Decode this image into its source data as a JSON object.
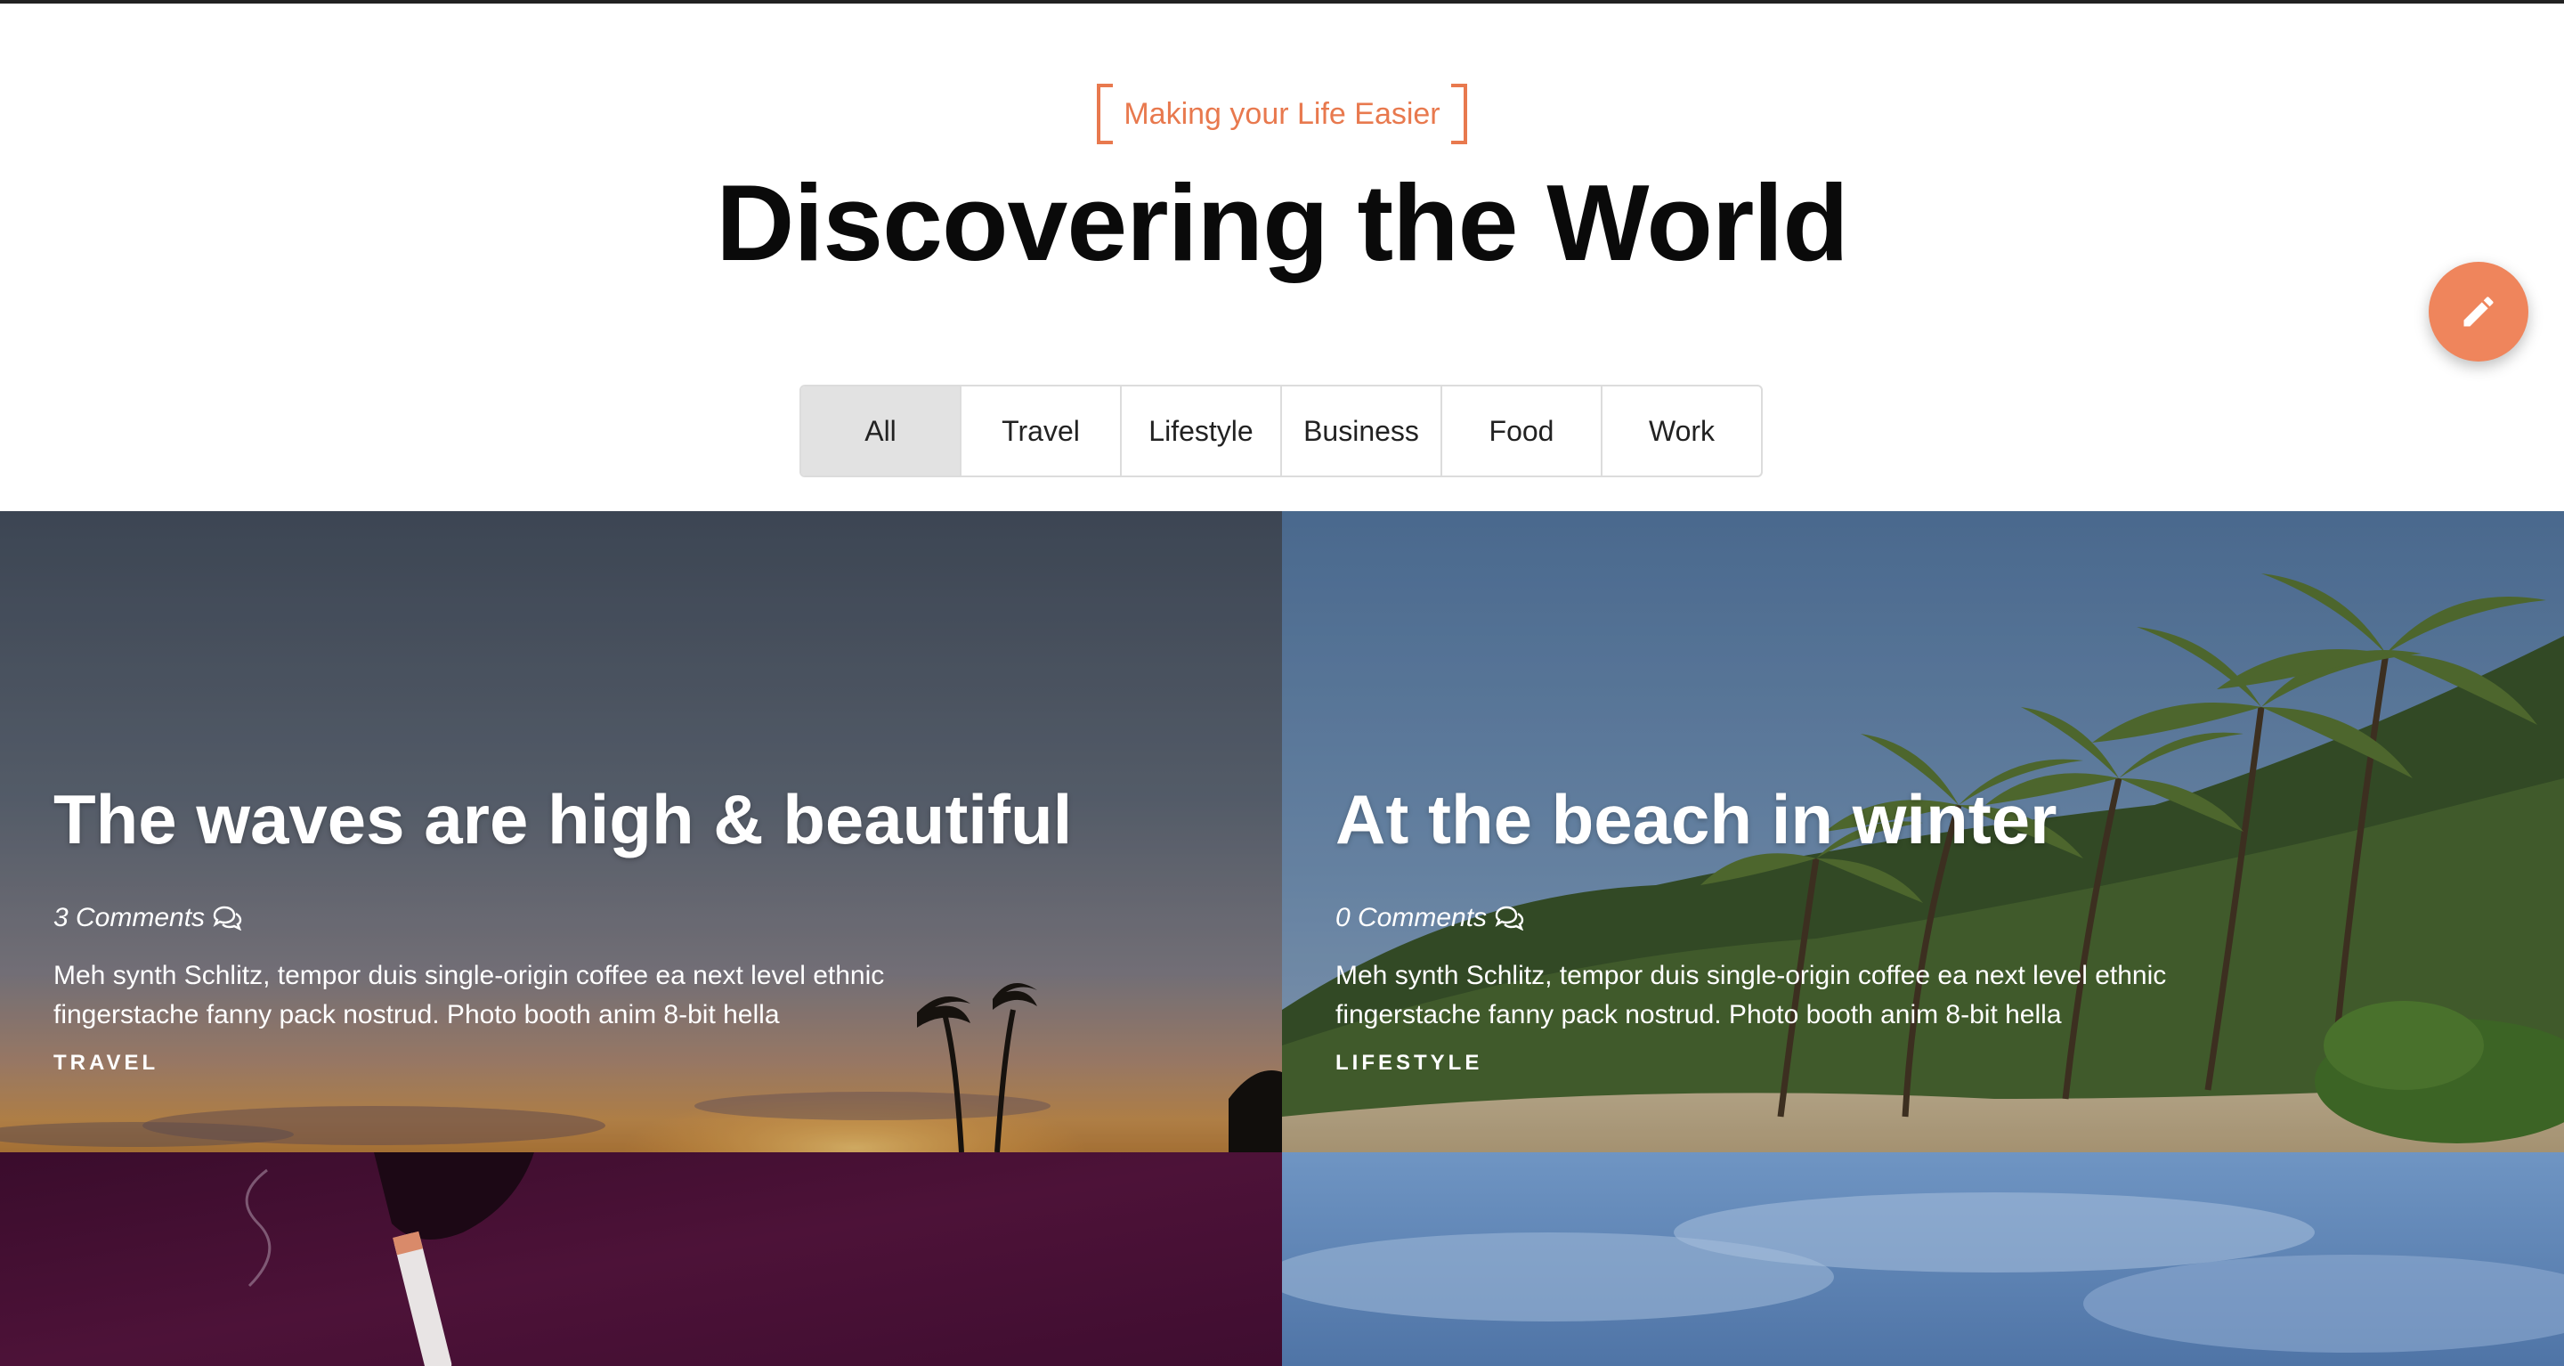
{
  "header": {
    "eyebrow": "Making your Life Easier",
    "title": "Discovering the World"
  },
  "fab": {
    "icon": "pencil-icon",
    "color": "#ef855c"
  },
  "filters": [
    {
      "label": "All",
      "active": true
    },
    {
      "label": "Travel",
      "active": false
    },
    {
      "label": "Lifestyle",
      "active": false
    },
    {
      "label": "Business",
      "active": false
    },
    {
      "label": "Food",
      "active": false
    },
    {
      "label": "Work",
      "active": false
    }
  ],
  "posts": [
    {
      "title": "The waves are high & beautiful",
      "comments": "3 Comments",
      "excerpt": "Meh synth Schlitz, tempor duis single-origin coffee ea next level ethnic fingerstache fanny pack nostrud. Photo booth anim 8-bit hella",
      "tag": "TRAVEL"
    },
    {
      "title": "At the beach in winter",
      "comments": "0 Comments",
      "excerpt": "Meh synth Schlitz, tempor duis single-origin coffee ea next level ethnic fingerstache fanny pack nostrud. Photo booth anim 8-bit hella",
      "tag": "LIFESTYLE"
    }
  ],
  "colors": {
    "accent": "#e8794e",
    "title": "#0a0a0a"
  }
}
